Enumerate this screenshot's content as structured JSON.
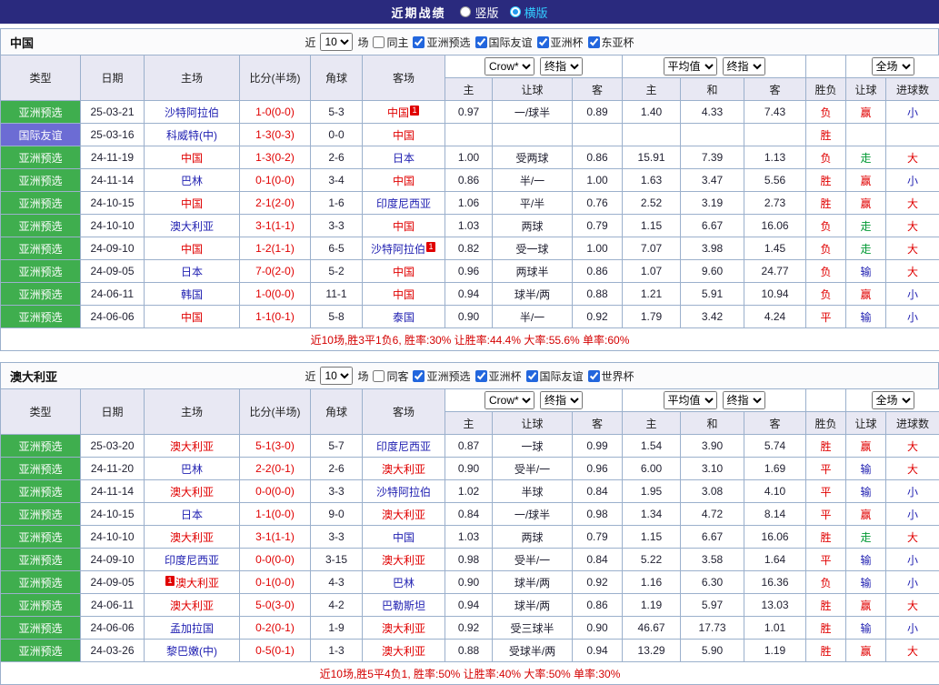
{
  "header": {
    "title": "近期战绩",
    "layout_options": [
      {
        "label": "竖版",
        "selected": false
      },
      {
        "label": "横版",
        "selected": true
      }
    ]
  },
  "table_headers": {
    "main": [
      "类型",
      "日期",
      "主场",
      "比分(半场)",
      "角球",
      "客场"
    ],
    "sub": [
      "主",
      "让球",
      "客",
      "主",
      "和",
      "客",
      "胜负",
      "让球",
      "进球数"
    ],
    "selects": {
      "odds_company": "Crow*",
      "odds_stage": "终指",
      "avg_label": "平均值",
      "avg_stage": "终指",
      "scope": "全场"
    }
  },
  "sections": [
    {
      "team": "中国",
      "filter": {
        "near": "近",
        "count": "10",
        "unit": "场",
        "checkboxes": [
          {
            "label": "同主",
            "checked": false
          },
          {
            "label": "亚洲预选",
            "checked": true
          },
          {
            "label": "国际友谊",
            "checked": true
          },
          {
            "label": "亚洲杯",
            "checked": true
          },
          {
            "label": "东亚杯",
            "checked": true
          }
        ]
      },
      "rows": [
        {
          "type": "亚洲预选",
          "tcls": "green",
          "date": "25-03-21",
          "home": "沙特阿拉伯",
          "hcls": "b",
          "score": "1-0(0-0)",
          "corner": "5-3",
          "away": "中国",
          "acls": "r",
          "abadge": "1",
          "o1": "0.97",
          "hc": "一/球半",
          "o2": "0.89",
          "a1": "1.40",
          "a2": "4.33",
          "a3": "7.43",
          "res": "负",
          "rescls": "r",
          "hres": "赢",
          "hrescls": "r",
          "goal": "小",
          "goalcls": "b"
        },
        {
          "type": "国际友谊",
          "tcls": "purple",
          "date": "25-03-16",
          "home": "科威特(中)",
          "hcls": "b",
          "score": "1-3(0-3)",
          "corner": "0-0",
          "away": "中国",
          "acls": "r",
          "o1": "",
          "hc": "",
          "o2": "",
          "a1": "",
          "a2": "",
          "a3": "",
          "res": "胜",
          "rescls": "r",
          "hres": "",
          "hrescls": "",
          "goal": "",
          "goalcls": ""
        },
        {
          "type": "亚洲预选",
          "tcls": "green",
          "date": "24-11-19",
          "home": "中国",
          "hcls": "r",
          "score": "1-3(0-2)",
          "corner": "2-6",
          "away": "日本",
          "acls": "b",
          "o1": "1.00",
          "hc": "受两球",
          "o2": "0.86",
          "a1": "15.91",
          "a2": "7.39",
          "a3": "1.13",
          "res": "负",
          "rescls": "r",
          "hres": "走",
          "hrescls": "g",
          "goal": "大",
          "goalcls": "r"
        },
        {
          "type": "亚洲预选",
          "tcls": "green",
          "date": "24-11-14",
          "home": "巴林",
          "hcls": "b",
          "score": "0-1(0-0)",
          "corner": "3-4",
          "away": "中国",
          "acls": "r",
          "o1": "0.86",
          "hc": "半/一",
          "o2": "1.00",
          "a1": "1.63",
          "a2": "3.47",
          "a3": "5.56",
          "res": "胜",
          "rescls": "r",
          "hres": "赢",
          "hrescls": "r",
          "goal": "小",
          "goalcls": "b"
        },
        {
          "type": "亚洲预选",
          "tcls": "green",
          "date": "24-10-15",
          "home": "中国",
          "hcls": "r",
          "score": "2-1(2-0)",
          "corner": "1-6",
          "away": "印度尼西亚",
          "acls": "b",
          "o1": "1.06",
          "hc": "平/半",
          "o2": "0.76",
          "a1": "2.52",
          "a2": "3.19",
          "a3": "2.73",
          "res": "胜",
          "rescls": "r",
          "hres": "赢",
          "hrescls": "r",
          "goal": "大",
          "goalcls": "r"
        },
        {
          "type": "亚洲预选",
          "tcls": "green",
          "date": "24-10-10",
          "home": "澳大利亚",
          "hcls": "b",
          "score": "3-1(1-1)",
          "corner": "3-3",
          "away": "中国",
          "acls": "r",
          "o1": "1.03",
          "hc": "两球",
          "o2": "0.79",
          "a1": "1.15",
          "a2": "6.67",
          "a3": "16.06",
          "res": "负",
          "rescls": "r",
          "hres": "走",
          "hrescls": "g",
          "goal": "大",
          "goalcls": "r"
        },
        {
          "type": "亚洲预选",
          "tcls": "green",
          "date": "24-09-10",
          "home": "中国",
          "hcls": "r",
          "score": "1-2(1-1)",
          "corner": "6-5",
          "away": "沙特阿拉伯",
          "acls": "b",
          "abadge": "1",
          "o1": "0.82",
          "hc": "受一球",
          "o2": "1.00",
          "a1": "7.07",
          "a2": "3.98",
          "a3": "1.45",
          "res": "负",
          "rescls": "r",
          "hres": "走",
          "hrescls": "g",
          "goal": "大",
          "goalcls": "r"
        },
        {
          "type": "亚洲预选",
          "tcls": "green",
          "date": "24-09-05",
          "home": "日本",
          "hcls": "b",
          "score": "7-0(2-0)",
          "corner": "5-2",
          "away": "中国",
          "acls": "r",
          "o1": "0.96",
          "hc": "两球半",
          "o2": "0.86",
          "a1": "1.07",
          "a2": "9.60",
          "a3": "24.77",
          "res": "负",
          "rescls": "r",
          "hres": "输",
          "hrescls": "b",
          "goal": "大",
          "goalcls": "r"
        },
        {
          "type": "亚洲预选",
          "tcls": "green",
          "date": "24-06-11",
          "home": "韩国",
          "hcls": "b",
          "score": "1-0(0-0)",
          "corner": "11-1",
          "away": "中国",
          "acls": "r",
          "o1": "0.94",
          "hc": "球半/两",
          "o2": "0.88",
          "a1": "1.21",
          "a2": "5.91",
          "a3": "10.94",
          "res": "负",
          "rescls": "r",
          "hres": "赢",
          "hrescls": "r",
          "goal": "小",
          "goalcls": "b"
        },
        {
          "type": "亚洲预选",
          "tcls": "green",
          "date": "24-06-06",
          "home": "中国",
          "hcls": "r",
          "score": "1-1(0-1)",
          "corner": "5-8",
          "away": "泰国",
          "acls": "b",
          "o1": "0.90",
          "hc": "半/一",
          "o2": "0.92",
          "a1": "1.79",
          "a2": "3.42",
          "a3": "4.24",
          "res": "平",
          "rescls": "r",
          "hres": "输",
          "hrescls": "b",
          "goal": "小",
          "goalcls": "b"
        }
      ],
      "summary": "近10场,胜3平1负6, 胜率:30% 让胜率:44.4% 大率:55.6% 单率:60%"
    },
    {
      "team": "澳大利亚",
      "filter": {
        "near": "近",
        "count": "10",
        "unit": "场",
        "checkboxes": [
          {
            "label": "同客",
            "checked": false
          },
          {
            "label": "亚洲预选",
            "checked": true
          },
          {
            "label": "亚洲杯",
            "checked": true
          },
          {
            "label": "国际友谊",
            "checked": true
          },
          {
            "label": "世界杯",
            "checked": true
          }
        ]
      },
      "rows": [
        {
          "type": "亚洲预选",
          "tcls": "green",
          "date": "25-03-20",
          "home": "澳大利亚",
          "hcls": "r",
          "score": "5-1(3-0)",
          "corner": "5-7",
          "away": "印度尼西亚",
          "acls": "b",
          "o1": "0.87",
          "hc": "一球",
          "o2": "0.99",
          "a1": "1.54",
          "a2": "3.90",
          "a3": "5.74",
          "res": "胜",
          "rescls": "r",
          "hres": "赢",
          "hrescls": "r",
          "goal": "大",
          "goalcls": "r"
        },
        {
          "type": "亚洲预选",
          "tcls": "green",
          "date": "24-11-20",
          "home": "巴林",
          "hcls": "b",
          "score": "2-2(0-1)",
          "corner": "2-6",
          "away": "澳大利亚",
          "acls": "r",
          "o1": "0.90",
          "hc": "受半/一",
          "o2": "0.96",
          "a1": "6.00",
          "a2": "3.10",
          "a3": "1.69",
          "res": "平",
          "rescls": "r",
          "hres": "输",
          "hrescls": "b",
          "goal": "大",
          "goalcls": "r"
        },
        {
          "type": "亚洲预选",
          "tcls": "green",
          "date": "24-11-14",
          "home": "澳大利亚",
          "hcls": "r",
          "score": "0-0(0-0)",
          "corner": "3-3",
          "away": "沙特阿拉伯",
          "acls": "b",
          "o1": "1.02",
          "hc": "半球",
          "o2": "0.84",
          "a1": "1.95",
          "a2": "3.08",
          "a3": "4.10",
          "res": "平",
          "rescls": "r",
          "hres": "输",
          "hrescls": "b",
          "goal": "小",
          "goalcls": "b"
        },
        {
          "type": "亚洲预选",
          "tcls": "green",
          "date": "24-10-15",
          "home": "日本",
          "hcls": "b",
          "score": "1-1(0-0)",
          "corner": "9-0",
          "away": "澳大利亚",
          "acls": "r",
          "o1": "0.84",
          "hc": "一/球半",
          "o2": "0.98",
          "a1": "1.34",
          "a2": "4.72",
          "a3": "8.14",
          "res": "平",
          "rescls": "r",
          "hres": "赢",
          "hrescls": "r",
          "goal": "小",
          "goalcls": "b"
        },
        {
          "type": "亚洲预选",
          "tcls": "green",
          "date": "24-10-10",
          "home": "澳大利亚",
          "hcls": "r",
          "score": "3-1(1-1)",
          "corner": "3-3",
          "away": "中国",
          "acls": "b",
          "o1": "1.03",
          "hc": "两球",
          "o2": "0.79",
          "a1": "1.15",
          "a2": "6.67",
          "a3": "16.06",
          "res": "胜",
          "rescls": "r",
          "hres": "走",
          "hrescls": "g",
          "goal": "大",
          "goalcls": "r"
        },
        {
          "type": "亚洲预选",
          "tcls": "green",
          "date": "24-09-10",
          "home": "印度尼西亚",
          "hcls": "b",
          "score": "0-0(0-0)",
          "corner": "3-15",
          "away": "澳大利亚",
          "acls": "r",
          "o1": "0.98",
          "hc": "受半/一",
          "o2": "0.84",
          "a1": "5.22",
          "a2": "3.58",
          "a3": "1.64",
          "res": "平",
          "rescls": "r",
          "hres": "输",
          "hrescls": "b",
          "goal": "小",
          "goalcls": "b"
        },
        {
          "type": "亚洲预选",
          "tcls": "green",
          "date": "24-09-05",
          "home": "澳大利亚",
          "hcls": "r",
          "hbadge": "1",
          "score": "0-1(0-0)",
          "corner": "4-3",
          "away": "巴林",
          "acls": "b",
          "o1": "0.90",
          "hc": "球半/两",
          "o2": "0.92",
          "a1": "1.16",
          "a2": "6.30",
          "a3": "16.36",
          "res": "负",
          "rescls": "r",
          "hres": "输",
          "hrescls": "b",
          "goal": "小",
          "goalcls": "b"
        },
        {
          "type": "亚洲预选",
          "tcls": "green",
          "date": "24-06-11",
          "home": "澳大利亚",
          "hcls": "r",
          "score": "5-0(3-0)",
          "corner": "4-2",
          "away": "巴勒斯坦",
          "acls": "b",
          "o1": "0.94",
          "hc": "球半/两",
          "o2": "0.86",
          "a1": "1.19",
          "a2": "5.97",
          "a3": "13.03",
          "res": "胜",
          "rescls": "r",
          "hres": "赢",
          "hrescls": "r",
          "goal": "大",
          "goalcls": "r"
        },
        {
          "type": "亚洲预选",
          "tcls": "green",
          "date": "24-06-06",
          "home": "孟加拉国",
          "hcls": "b",
          "score": "0-2(0-1)",
          "corner": "1-9",
          "away": "澳大利亚",
          "acls": "r",
          "o1": "0.92",
          "hc": "受三球半",
          "o2": "0.90",
          "a1": "46.67",
          "a2": "17.73",
          "a3": "1.01",
          "res": "胜",
          "rescls": "r",
          "hres": "输",
          "hrescls": "b",
          "goal": "小",
          "goalcls": "b"
        },
        {
          "type": "亚洲预选",
          "tcls": "green",
          "date": "24-03-26",
          "home": "黎巴嫩(中)",
          "hcls": "b",
          "score": "0-5(0-1)",
          "corner": "1-3",
          "away": "澳大利亚",
          "acls": "r",
          "o1": "0.88",
          "hc": "受球半/两",
          "o2": "0.94",
          "a1": "13.29",
          "a2": "5.90",
          "a3": "1.19",
          "res": "胜",
          "rescls": "r",
          "hres": "赢",
          "hrescls": "r",
          "goal": "大",
          "goalcls": "r"
        }
      ],
      "summary": "近10场,胜5平4负1, 胜率:50% 让胜率:40% 大率:50% 单率:30%"
    }
  ]
}
